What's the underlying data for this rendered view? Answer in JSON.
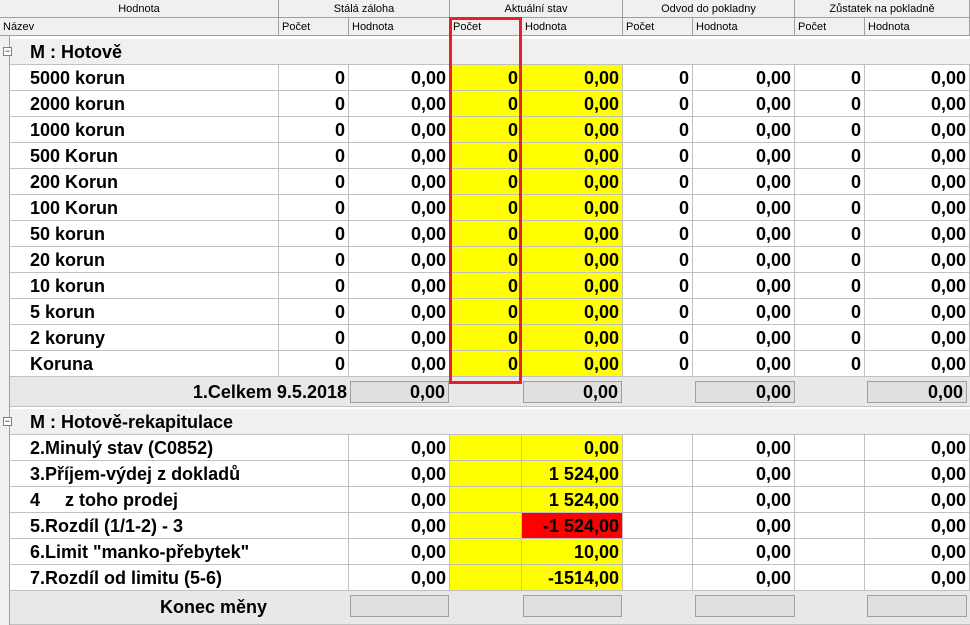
{
  "headers": {
    "top": [
      "Hodnota",
      "Stálá záloha",
      "Aktuální stav",
      "Odvod do pokladny",
      "Zůstatek na pokladně"
    ],
    "sub": [
      "Název",
      "Počet",
      "Hodnota",
      "Počet",
      "Hodnota",
      "Počet",
      "Hodnota",
      "Počet",
      "Hodnota"
    ]
  },
  "group1": {
    "title": "M : Hotově",
    "collapse_glyph": "−",
    "rows": [
      {
        "label": "5000 korun",
        "v": [
          "0",
          "0,00",
          "0",
          "0,00",
          "0",
          "0,00",
          "0",
          "0,00"
        ]
      },
      {
        "label": "2000 korun",
        "v": [
          "0",
          "0,00",
          "0",
          "0,00",
          "0",
          "0,00",
          "0",
          "0,00"
        ]
      },
      {
        "label": "1000 korun",
        "v": [
          "0",
          "0,00",
          "0",
          "0,00",
          "0",
          "0,00",
          "0",
          "0,00"
        ]
      },
      {
        "label": "500 Korun",
        "v": [
          "0",
          "0,00",
          "0",
          "0,00",
          "0",
          "0,00",
          "0",
          "0,00"
        ]
      },
      {
        "label": "200 Korun",
        "v": [
          "0",
          "0,00",
          "0",
          "0,00",
          "0",
          "0,00",
          "0",
          "0,00"
        ]
      },
      {
        "label": "100 Korun",
        "v": [
          "0",
          "0,00",
          "0",
          "0,00",
          "0",
          "0,00",
          "0",
          "0,00"
        ]
      },
      {
        "label": "50 korun",
        "v": [
          "0",
          "0,00",
          "0",
          "0,00",
          "0",
          "0,00",
          "0",
          "0,00"
        ]
      },
      {
        "label": "20 korun",
        "v": [
          "0",
          "0,00",
          "0",
          "0,00",
          "0",
          "0,00",
          "0",
          "0,00"
        ]
      },
      {
        "label": "10 korun",
        "v": [
          "0",
          "0,00",
          "0",
          "0,00",
          "0",
          "0,00",
          "0",
          "0,00"
        ]
      },
      {
        "label": "5 korun",
        "v": [
          "0",
          "0,00",
          "0",
          "0,00",
          "0",
          "0,00",
          "0",
          "0,00"
        ]
      },
      {
        "label": "2 koruny",
        "v": [
          "0",
          "0,00",
          "0",
          "0,00",
          "0",
          "0,00",
          "0",
          "0,00"
        ]
      },
      {
        "label": "Koruna",
        "v": [
          "0",
          "0,00",
          "0",
          "0,00",
          "0",
          "0,00",
          "0",
          "0,00"
        ]
      }
    ],
    "total": {
      "label": "1.Celkem 9.5.2018",
      "stala": "0,00",
      "aktualni": "0,00",
      "odvod": "0,00",
      "zustatek": "0,00"
    }
  },
  "group2": {
    "title": "M : Hotově-rekapitulace",
    "collapse_glyph": "−",
    "rows": [
      {
        "label": "2.Minulý stav (C0852)",
        "stala": "0,00",
        "aktualni": "0,00",
        "odvod": "0,00",
        "zustatek": "0,00",
        "red": false
      },
      {
        "label": "3.Příjem-výdej z dokladů",
        "stala": "0,00",
        "aktualni": "1 524,00",
        "odvod": "0,00",
        "zustatek": "0,00",
        "red": false
      },
      {
        "label": "4     z toho prodej",
        "stala": "0,00",
        "aktualni": "1 524,00",
        "odvod": "0,00",
        "zustatek": "0,00",
        "red": false
      },
      {
        "label": "5.Rozdíl (1/1-2) - 3",
        "stala": "0,00",
        "aktualni": "-1 524,00",
        "odvod": "0,00",
        "zustatek": "0,00",
        "red": true
      },
      {
        "label": "6.Limit \"manko-přebytek\"",
        "stala": "0,00",
        "aktualni": "10,00",
        "odvod": "0,00",
        "zustatek": "0,00",
        "red": false
      },
      {
        "label": "7.Rozdíl od limitu (5-6)",
        "stala": "0,00",
        "aktualni": "-1514,00",
        "odvod": "0,00",
        "zustatek": "0,00",
        "red": false
      }
    ],
    "footer": {
      "label": "Konec měny"
    }
  },
  "colors": {
    "highlight": "#ffff00",
    "alert": "#ff0000",
    "annotation_box": "#e8202a"
  }
}
